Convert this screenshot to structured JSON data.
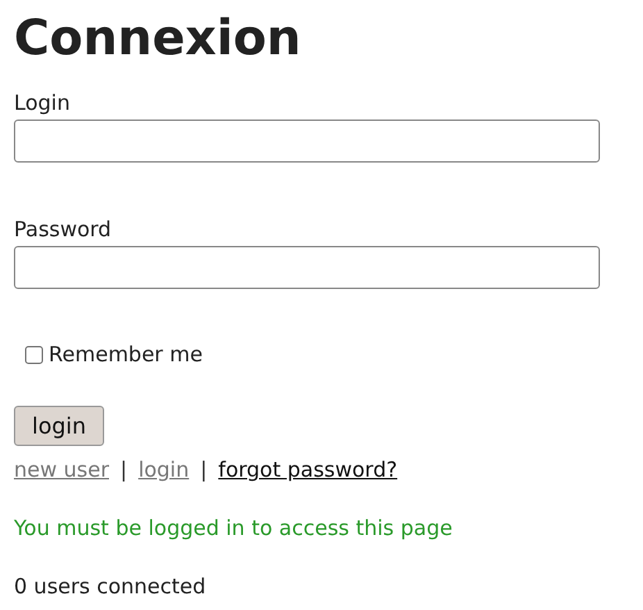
{
  "title": "Connexion",
  "fields": [
    {
      "label": "Login"
    },
    {
      "label": "Password"
    }
  ],
  "remember": {
    "label": "Remember me",
    "checked": false
  },
  "submit": "login",
  "links": [
    {
      "label": "new user",
      "visited": true
    },
    {
      "label": "login",
      "visited": true
    },
    {
      "label": "forgot password?",
      "visited": false
    }
  ],
  "separator": "|",
  "message": "You must be logged in to access this page",
  "status": "0 users connected"
}
